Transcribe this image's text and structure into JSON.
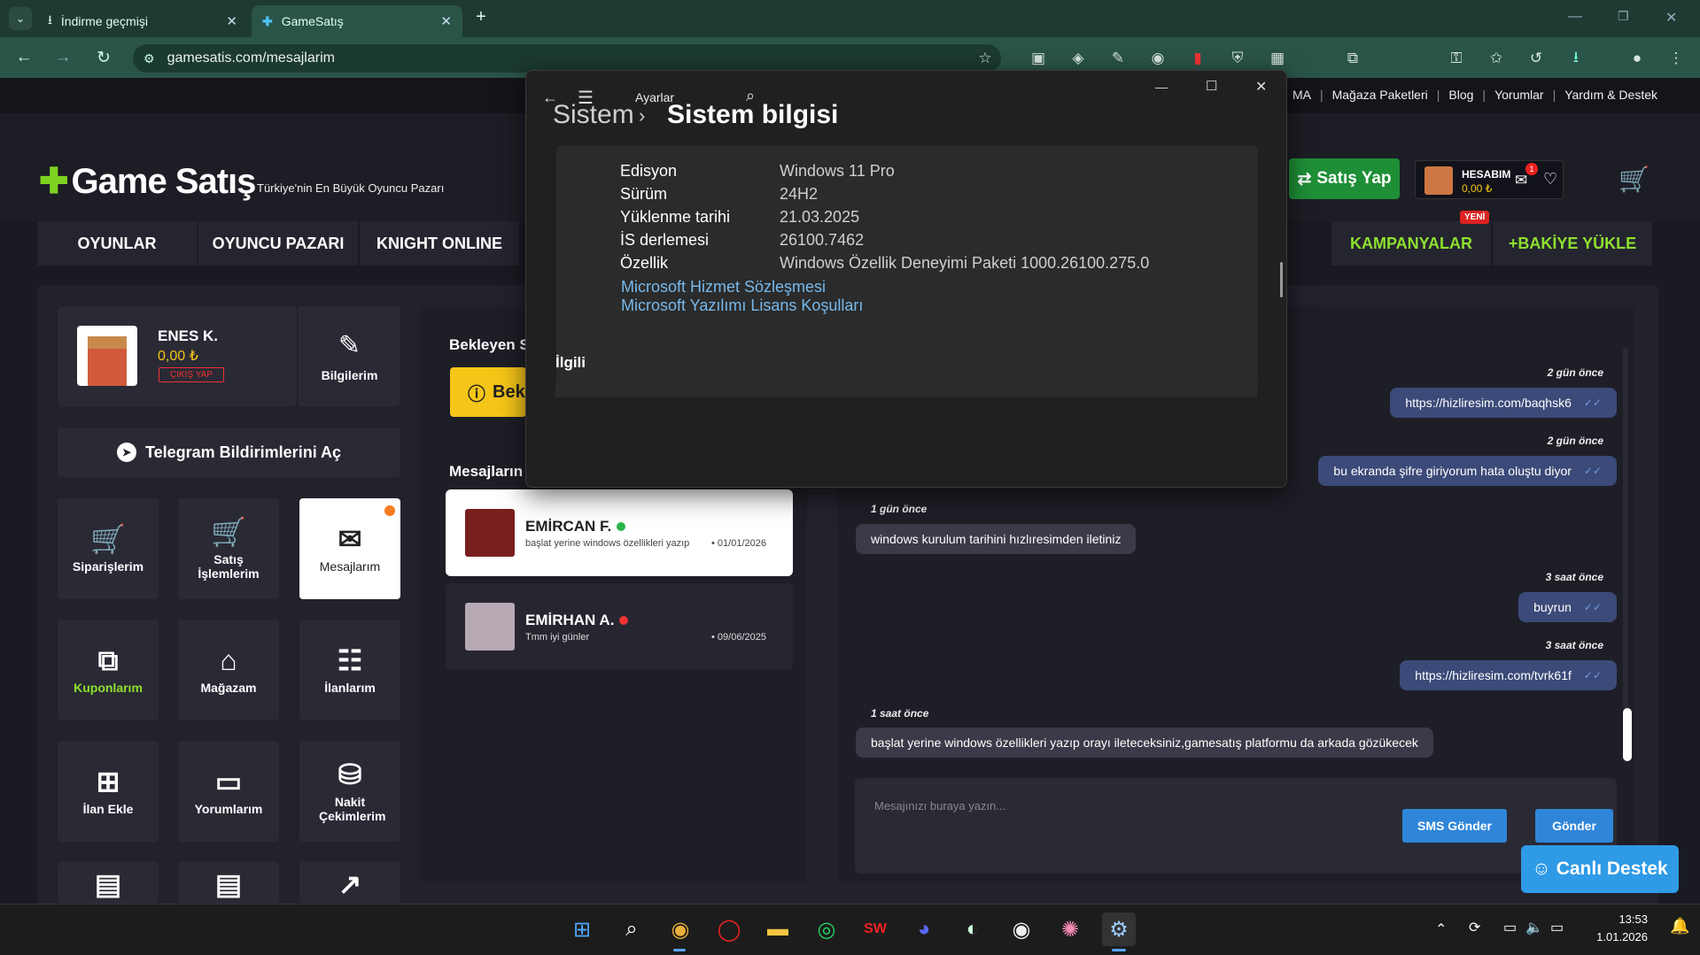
{
  "browser": {
    "tabs": [
      {
        "label": "İndirme geçmişi"
      },
      {
        "label": "GameSatış"
      }
    ],
    "url": "gamesatis.com/mesajlarim"
  },
  "site": {
    "top_links": [
      "MA",
      "Mağaza Paketleri",
      "Blog",
      "Yorumlar",
      "Yardım & Destek"
    ],
    "logo_text": "Game Satış",
    "tagline": "Türkiye'nin En Büyük Oyuncu Pazarı",
    "sell_button": "Satış Yap",
    "account": {
      "label": "HESABIM",
      "balance": "0,00 ₺",
      "badge": "1"
    },
    "menu": [
      "OYUNLAR",
      "OYUNCU PAZARI",
      "KNIGHT ONLINE",
      "KAMPANYALAR",
      "+BAKİYE YÜKLE"
    ],
    "new_badge": "YENİ"
  },
  "profile": {
    "name": "ENES K.",
    "balance": "0,00 ₺",
    "logout": "ÇIKIŞ YAP",
    "info_label": "Bilgilerim"
  },
  "telegram_button": "Telegram Bildirimlerini Aç",
  "tiles": [
    {
      "label": "Siparişlerim",
      "icon": "cart-down-icon"
    },
    {
      "label": "Satış İşlemlerim",
      "icon": "cart-up-icon"
    },
    {
      "label": "Mesajlarım",
      "icon": "mail-icon"
    },
    {
      "label": "Kuponlarım",
      "icon": "coupon-icon"
    },
    {
      "label": "Mağazam",
      "icon": "store-icon"
    },
    {
      "label": "İlanlarım",
      "icon": "clipboard-icon"
    },
    {
      "label": "İlan Ekle",
      "icon": "clipboard-add-icon"
    },
    {
      "label": "Yorumlarım",
      "icon": "comment-icon"
    },
    {
      "label": "Nakit Çekimlerim",
      "icon": "coins-icon"
    }
  ],
  "middle": {
    "pending_title": "Bekleyen S",
    "pending_button": "Bek",
    "messages_title": "Mesajların",
    "conversations": [
      {
        "name": "EMİRCAN F.",
        "preview": "başlat yerine windows özellikleri yazıp",
        "date": "01/01/2026",
        "status": "online"
      },
      {
        "name": "EMİRHAN A.",
        "preview": "Tmm iyi günler",
        "date": "09/06/2025",
        "status": "offline"
      }
    ]
  },
  "chat": {
    "messages": [
      {
        "time": "2 gün önce",
        "text": "https://hizliresim.com/baqhsk6",
        "dir": "out"
      },
      {
        "time": "2 gün önce",
        "text": "bu ekranda şifre giriyorum hata oluştu diyor",
        "dir": "out"
      },
      {
        "time": "1 gün önce",
        "text": "windows kurulum tarihini hızlıresimden iletiniz",
        "dir": "in"
      },
      {
        "time": "3 saat önce",
        "text": "buyrun",
        "dir": "out"
      },
      {
        "time": "3 saat önce",
        "text": "https://hizliresim.com/tvrk61f",
        "dir": "out"
      },
      {
        "time": "1 saat önce",
        "text": "başlat yerine windows özellikleri yazıp orayı ileteceksiniz,gamesatış platformu da arkada gözükecek",
        "dir": "in"
      }
    ],
    "placeholder": "Mesajınızı buraya yazın...",
    "sms_button": "SMS Gönder",
    "send_button": "Gönder",
    "live_support": "Canlı Destek"
  },
  "settings_window": {
    "app_title": "Ayarlar",
    "breadcrumb_parent": "Sistem",
    "breadcrumb_current": "Sistem bilgisi",
    "rows": [
      {
        "label": "Edisyon",
        "value": "Windows 11 Pro"
      },
      {
        "label": "Sürüm",
        "value": "24H2"
      },
      {
        "label": "Yüklenme tarihi",
        "value": "21.03.2025"
      },
      {
        "label": "İS derlemesi",
        "value": "26100.7462"
      },
      {
        "label": "Özellik",
        "value": "Windows Özellik Deneyimi Paketi 1000.26100.275.0"
      }
    ],
    "links": [
      "Microsoft Hizmet Sözleşmesi",
      "Microsoft Yazılımı Lisans Koşulları"
    ],
    "related": "İlgili"
  },
  "taskbar": {
    "time": "13:53",
    "date": "1.01.2026"
  },
  "colors": {
    "accent_green": "#8de02f",
    "chat_out": "#3b4a78",
    "button_blue": "#2f86d9",
    "link_blue": "#76b9ed"
  }
}
